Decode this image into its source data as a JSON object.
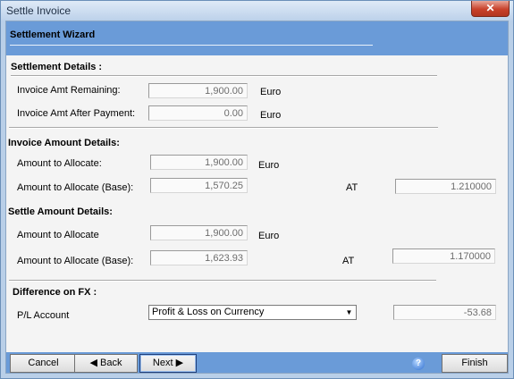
{
  "window": {
    "title": "Settle Invoice",
    "close_glyph": "✕"
  },
  "header": {
    "title": "Settlement Wizard"
  },
  "settlement_details": {
    "heading": "Settlement Details :",
    "remaining_label": "Invoice Amt Remaining:",
    "remaining_value": "1,900.00",
    "remaining_currency": "Euro",
    "after_payment_label": "Invoice Amt After Payment:",
    "after_payment_value": "0.00",
    "after_payment_currency": "Euro"
  },
  "invoice_amount_details": {
    "heading": "Invoice Amount Details:",
    "allocate_label": "Amount to Allocate:",
    "allocate_value": "1,900.00",
    "allocate_currency": "Euro",
    "allocate_base_label": "Amount to Allocate (Base):",
    "allocate_base_value": "1,570.25",
    "rate_label": "AT",
    "rate_value": "1.210000"
  },
  "settle_amount_details": {
    "heading": "Settle Amount Details:",
    "allocate_label": "Amount to Allocate",
    "allocate_value": "1,900.00",
    "allocate_currency": "Euro",
    "allocate_base_label": "Amount to Allocate (Base):",
    "allocate_base_value": "1,623.93",
    "rate_label": "AT",
    "rate_value": "1.170000"
  },
  "difference_fx": {
    "heading": "Difference on FX :",
    "account_label": "P/L Account",
    "account_selected": "Profit & Loss on Currency",
    "difference_value": "-53.68"
  },
  "footer": {
    "cancel_label": "Cancel",
    "back_label": "Back",
    "back_glyph": "◀",
    "next_label": "Next",
    "next_glyph": "▶",
    "help_glyph": "?",
    "finish_label": "Finish"
  },
  "icons": {
    "help": "help-icon",
    "close": "close-icon",
    "dropdown": "chevron-down-icon"
  }
}
